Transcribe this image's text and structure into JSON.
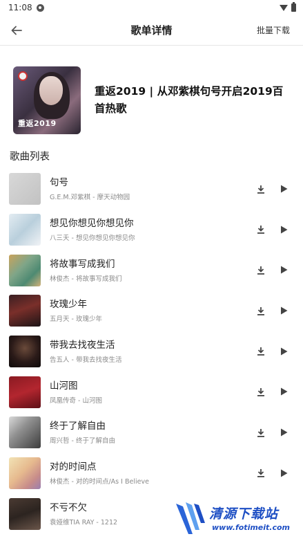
{
  "status_bar": {
    "time": "11:08"
  },
  "app_bar": {
    "title": "歌单详情",
    "batch_download": "批量下载"
  },
  "playlist": {
    "title": "重返2019 | 从邓紫棋句号开启2019百首热歌",
    "cover_text": "重返2019"
  },
  "section": {
    "title": "歌曲列表"
  },
  "songs": [
    {
      "title": "句号",
      "subtitle": "G.E.M.邓紫棋 - 摩天动物园"
    },
    {
      "title": "想见你想见你想见你",
      "subtitle": "八三夭 - 想见你想见你想见你"
    },
    {
      "title": "将故事写成我们",
      "subtitle": "林俊杰 - 将故事写成我们"
    },
    {
      "title": "玫瑰少年",
      "subtitle": "五月天 - 玫瑰少年"
    },
    {
      "title": "带我去找夜生活",
      "subtitle": "告五人 - 带我去找夜生活"
    },
    {
      "title": "山河图",
      "subtitle": "凤凰传奇 - 山河图"
    },
    {
      "title": "终于了解自由",
      "subtitle": "周兴哲 - 终于了解自由"
    },
    {
      "title": "对的时间点",
      "subtitle": "林俊杰 - 对的时间点/As I Believe"
    },
    {
      "title": "不亏不欠",
      "subtitle": "袁娅维TIA RAY - 1212"
    }
  ],
  "watermark": {
    "text": "清源下载站",
    "url": "www.fotimeit.com"
  }
}
